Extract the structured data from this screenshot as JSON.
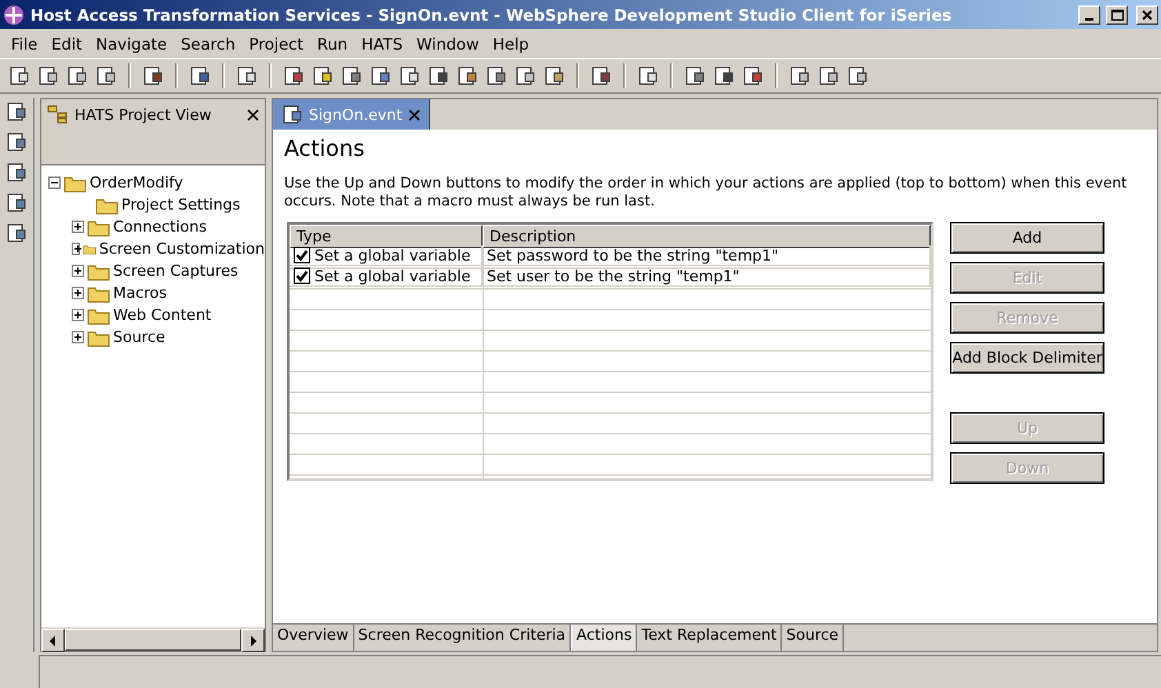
{
  "window": {
    "title": "Host Access Transformation Services - SignOn.evnt - WebSphere Development Studio Client for iSeries"
  },
  "menu": [
    "File",
    "Edit",
    "Navigate",
    "Search",
    "Project",
    "Run",
    "HATS",
    "Window",
    "Help"
  ],
  "project_view": {
    "title": "HATS Project View",
    "tree": [
      {
        "label": "OrderModify",
        "expanded": true,
        "children": [
          {
            "label": "Project Settings",
            "expandable": false
          },
          {
            "label": "Connections",
            "expandable": true
          },
          {
            "label": "Screen Customization",
            "expandable": true
          },
          {
            "label": "Screen Captures",
            "expandable": true
          },
          {
            "label": "Macros",
            "expandable": true
          },
          {
            "label": "Web Content",
            "expandable": true
          },
          {
            "label": "Source",
            "expandable": true
          }
        ]
      }
    ]
  },
  "editor": {
    "tab": "SignOn.evnt",
    "heading": "Actions",
    "description": "Use the Up and Down buttons to modify the order in which your actions are applied (top to bottom) when this event occurs. Note that a macro must always be run last.",
    "columns": [
      "Type",
      "Description"
    ],
    "rows": [
      {
        "checked": true,
        "type": "Set a global variable",
        "description": "Set password to be the string \"temp1\""
      },
      {
        "checked": true,
        "type": "Set a global variable",
        "description": "Set user to be the string \"temp1\""
      }
    ],
    "button_groups": [
      [
        {
          "label": "Add",
          "disabled": false
        },
        {
          "label": "Edit",
          "disabled": true
        },
        {
          "label": "Remove",
          "disabled": true
        },
        {
          "label": "Add Block Delimiter",
          "disabled": false
        }
      ],
      [
        {
          "label": "Up",
          "disabled": true
        },
        {
          "label": "Down",
          "disabled": true
        }
      ]
    ],
    "page_tabs": [
      {
        "label": "Overview",
        "selected": false
      },
      {
        "label": "Screen Recognition Criteria",
        "selected": false
      },
      {
        "label": "Actions",
        "selected": true
      },
      {
        "label": "Text Replacement",
        "selected": false
      },
      {
        "label": "Source",
        "selected": false
      }
    ]
  }
}
